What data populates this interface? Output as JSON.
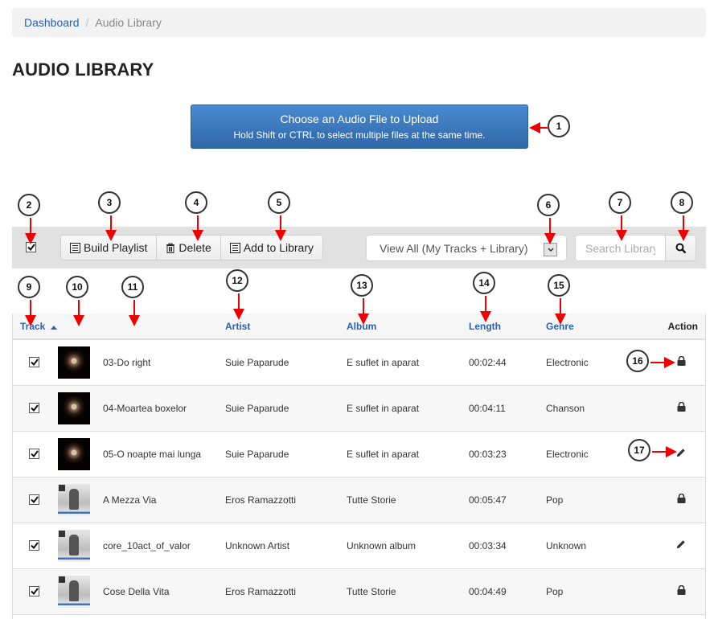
{
  "breadcrumb": {
    "items": [
      {
        "label": "Dashboard",
        "link": true
      },
      {
        "label": "Audio Library",
        "link": false
      }
    ],
    "separator": "/"
  },
  "page_title": "AUDIO LIBRARY",
  "upload": {
    "title": "Choose an Audio File to Upload",
    "hint": "Hold Shift or CTRL to select multiple files at the same time."
  },
  "toolbar": {
    "select_all_checked": true,
    "buttons": [
      {
        "label": "Build Playlist",
        "icon": "list-icon"
      },
      {
        "label": "Delete",
        "icon": "trash-icon"
      },
      {
        "label": "Add to Library",
        "icon": "list-icon"
      }
    ],
    "view_filter": {
      "selected": "View All (My Tracks + Library)"
    },
    "search": {
      "placeholder": "Search Library",
      "value": ""
    }
  },
  "table": {
    "columns": [
      {
        "label": "Track",
        "sortable": true,
        "sort": "asc"
      },
      {
        "label": "",
        "sortable": false
      },
      {
        "label": "",
        "sortable": false
      },
      {
        "label": "Artist",
        "sortable": true
      },
      {
        "label": "Album",
        "sortable": true
      },
      {
        "label": "Length",
        "sortable": true
      },
      {
        "label": "Genre",
        "sortable": true
      },
      {
        "label": "Action",
        "sortable": false
      }
    ],
    "rows": [
      {
        "checked": true,
        "art": "dark",
        "title": "03-Do right",
        "artist": "Suie Paparude",
        "album": "E suflet in aparat",
        "length": "00:02:44",
        "genre": "Electronic",
        "action": "lock-icon"
      },
      {
        "checked": true,
        "art": "dark",
        "title": "04-Moartea boxelor",
        "artist": "Suie Paparude",
        "album": "E suflet in aparat",
        "length": "00:04:11",
        "genre": "Chanson",
        "action": "lock-icon"
      },
      {
        "checked": true,
        "art": "dark",
        "title": "05-O noapte mai lunga",
        "artist": "Suie Paparude",
        "album": "E suflet in aparat",
        "length": "00:03:23",
        "genre": "Electronic",
        "action": "pencil-icon"
      },
      {
        "checked": true,
        "art": "light",
        "title": "A Mezza Via",
        "artist": "Eros Ramazzotti",
        "album": "Tutte Storie",
        "length": "00:05:47",
        "genre": "Pop",
        "action": "lock-icon"
      },
      {
        "checked": true,
        "art": "light",
        "title": "core_10act_of_valor",
        "artist": "Unknown Artist",
        "album": "Unknown album",
        "length": "00:03:34",
        "genre": "Unknown",
        "action": "pencil-icon"
      },
      {
        "checked": true,
        "art": "light",
        "title": "Cose Della Vita",
        "artist": "Eros Ramazzotti",
        "album": "Tutte Storie",
        "length": "00:04:49",
        "genre": "Pop",
        "action": "lock-icon"
      }
    ]
  },
  "callouts": [
    "1",
    "2",
    "3",
    "4",
    "5",
    "6",
    "7",
    "8",
    "9",
    "10",
    "11",
    "12",
    "13",
    "14",
    "15",
    "16",
    "17"
  ],
  "colors": {
    "link": "#2a62b4",
    "primary": "#3a78c2",
    "annotation_arrow": "#ee0000",
    "toolbar_bg": "#e1e1e1"
  }
}
